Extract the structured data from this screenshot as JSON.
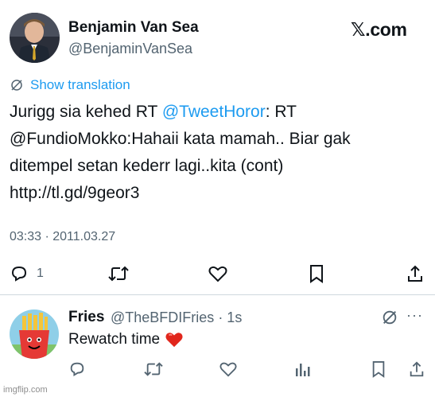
{
  "tweet": {
    "author_name": "Benjamin Van Sea",
    "author_handle": "@BenjaminVanSea",
    "brand": "𝕏.com",
    "show_translation": "Show translation",
    "text_before": "Jurigg sia kehed RT ",
    "mention": "@TweetHoror",
    "text_after": ": RT @FundioMokko:Hahaii kata mamah.. Biar gak ditempel setan kederr lagi..kita (cont) http://tl.gd/9geor3",
    "timestamp": "03:33 · 2011.03.27",
    "reply_count": "1",
    "icons": [
      "reply-icon",
      "retweet-icon",
      "like-icon",
      "bookmark-icon",
      "share-icon"
    ]
  },
  "reply": {
    "author_name": "Fries",
    "author_handle": "@TheBFDIFries",
    "age": "· 1s",
    "text": "Rewatch time",
    "emoji": "❤️",
    "more": "···",
    "icons": [
      "reply-icon",
      "retweet-icon",
      "like-icon",
      "views-icon",
      "bookmark-icon",
      "share-icon"
    ]
  },
  "watermark": "imgflip.com",
  "colors": {
    "accent": "#1d9bf0",
    "text": "#0f1419",
    "muted": "#536471",
    "divider": "#cfd9de"
  }
}
